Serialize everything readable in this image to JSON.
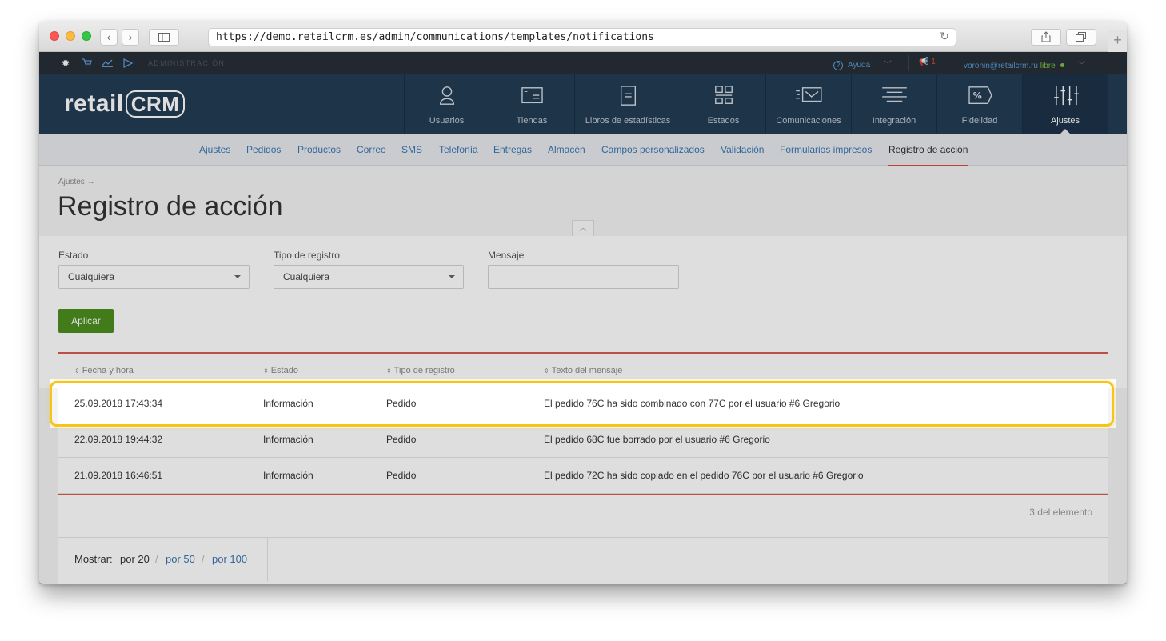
{
  "browser": {
    "url": "https://demo.retailcrm.es/admin/communications/templates/notifications",
    "reload_glyph": "↻",
    "back_glyph": "‹",
    "forward_glyph": "›",
    "new_tab_glyph": "+"
  },
  "topbar": {
    "section": "ADMINISTRACIÓN",
    "help": "Ayuda",
    "notifications_count": "1",
    "user_email": "voronin@retailcrm.ru",
    "user_status": "libre"
  },
  "header": {
    "logo_text": "retail",
    "logo_crm": "CRM",
    "nav": [
      {
        "label": "Usuarios",
        "icon": "user-icon"
      },
      {
        "label": "Tiendas",
        "icon": "store-icon"
      },
      {
        "label": "Libros de estadísticas",
        "icon": "book-icon"
      },
      {
        "label": "Estados",
        "icon": "status-grid-icon"
      },
      {
        "label": "Comunicaciones",
        "icon": "mail-icon"
      },
      {
        "label": "Integración",
        "icon": "integration-icon"
      },
      {
        "label": "Fidelidad",
        "icon": "discount-tag-icon"
      },
      {
        "label": "Ajustes",
        "icon": "sliders-icon"
      }
    ]
  },
  "subnav": {
    "items": [
      "Ajustes",
      "Pedidos",
      "Productos",
      "Correo",
      "SMS",
      "Telefonía",
      "Entregas",
      "Almacén",
      "Campos personalizados",
      "Validación",
      "Formularios impresos",
      "Registro de acción"
    ]
  },
  "page": {
    "breadcrumb": "Ajustes →",
    "title": "Registro de acción"
  },
  "filters": {
    "estado_label": "Estado",
    "estado_value": "Cualquiera",
    "tipo_label": "Tipo de registro",
    "tipo_value": "Cualquiera",
    "mensaje_label": "Mensaje",
    "mensaje_value": "",
    "apply_label": "Aplicar"
  },
  "table": {
    "headers": [
      "Fecha y hora",
      "Estado",
      "Tipo de registro",
      "Texto del mensaje"
    ],
    "rows": [
      {
        "date": "25.09.2018 17:43:34",
        "status": "Información",
        "type": "Pedido",
        "message": "El pedido 76C ha sido combinado con 77C por el usuario #6 Gregorio"
      },
      {
        "date": "22.09.2018 19:44:32",
        "status": "Información",
        "type": "Pedido",
        "message": "El pedido 68C fue borrado por el usuario #6 Gregorio"
      },
      {
        "date": "21.09.2018 16:46:51",
        "status": "Información",
        "type": "Pedido",
        "message": "El pedido 72C ha sido copiado en el pedido 76C por el usuario #6 Gregorio"
      }
    ],
    "count_text": "3 del elemento"
  },
  "pager": {
    "show_label": "Mostrar:",
    "current": "por 20",
    "options": [
      "por 50",
      "por 100"
    ],
    "separator": "/"
  },
  "colors": {
    "header_bg": "#233c54",
    "topbar_bg": "#262e37",
    "accent_red": "#e2473d",
    "apply_green": "#4c8f1e",
    "link_blue": "#3b77b3",
    "highlight_yellow": "#f5c518"
  }
}
